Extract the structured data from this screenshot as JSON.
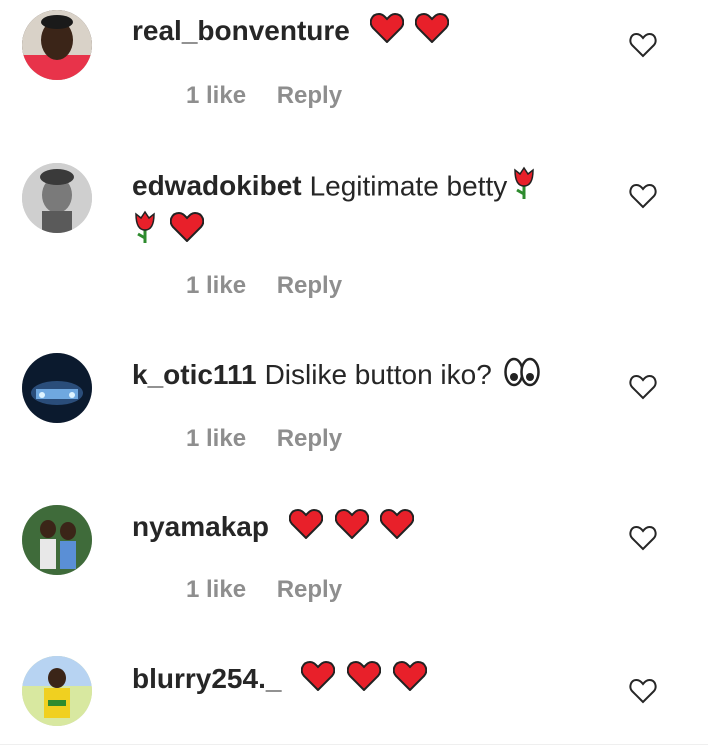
{
  "comments": [
    {
      "username": "real_bonventure",
      "text": "",
      "emoji": [
        "red-heart",
        "red-heart"
      ],
      "likes": "1 like",
      "reply": "Reply"
    },
    {
      "username": "edwadokibet",
      "text": "Legitimate betty",
      "emoji": [
        "rose",
        "rose",
        "red-heart"
      ],
      "likes": "1 like",
      "reply": "Reply"
    },
    {
      "username": "k_otic111",
      "text": "Dislike button iko?",
      "emoji": [
        "eyes"
      ],
      "likes": "1 like",
      "reply": "Reply"
    },
    {
      "username": "nyamakap",
      "text": "",
      "emoji": [
        "red-heart",
        "red-heart",
        "red-heart"
      ],
      "likes": "1 like",
      "reply": "Reply"
    },
    {
      "username": "blurry254._",
      "text": "",
      "emoji": [
        "red-heart",
        "red-heart",
        "red-heart"
      ]
    }
  ],
  "colors": {
    "text": "#262626",
    "secondary": "#8e8e8e",
    "heart_emoji": "#e8202a"
  }
}
